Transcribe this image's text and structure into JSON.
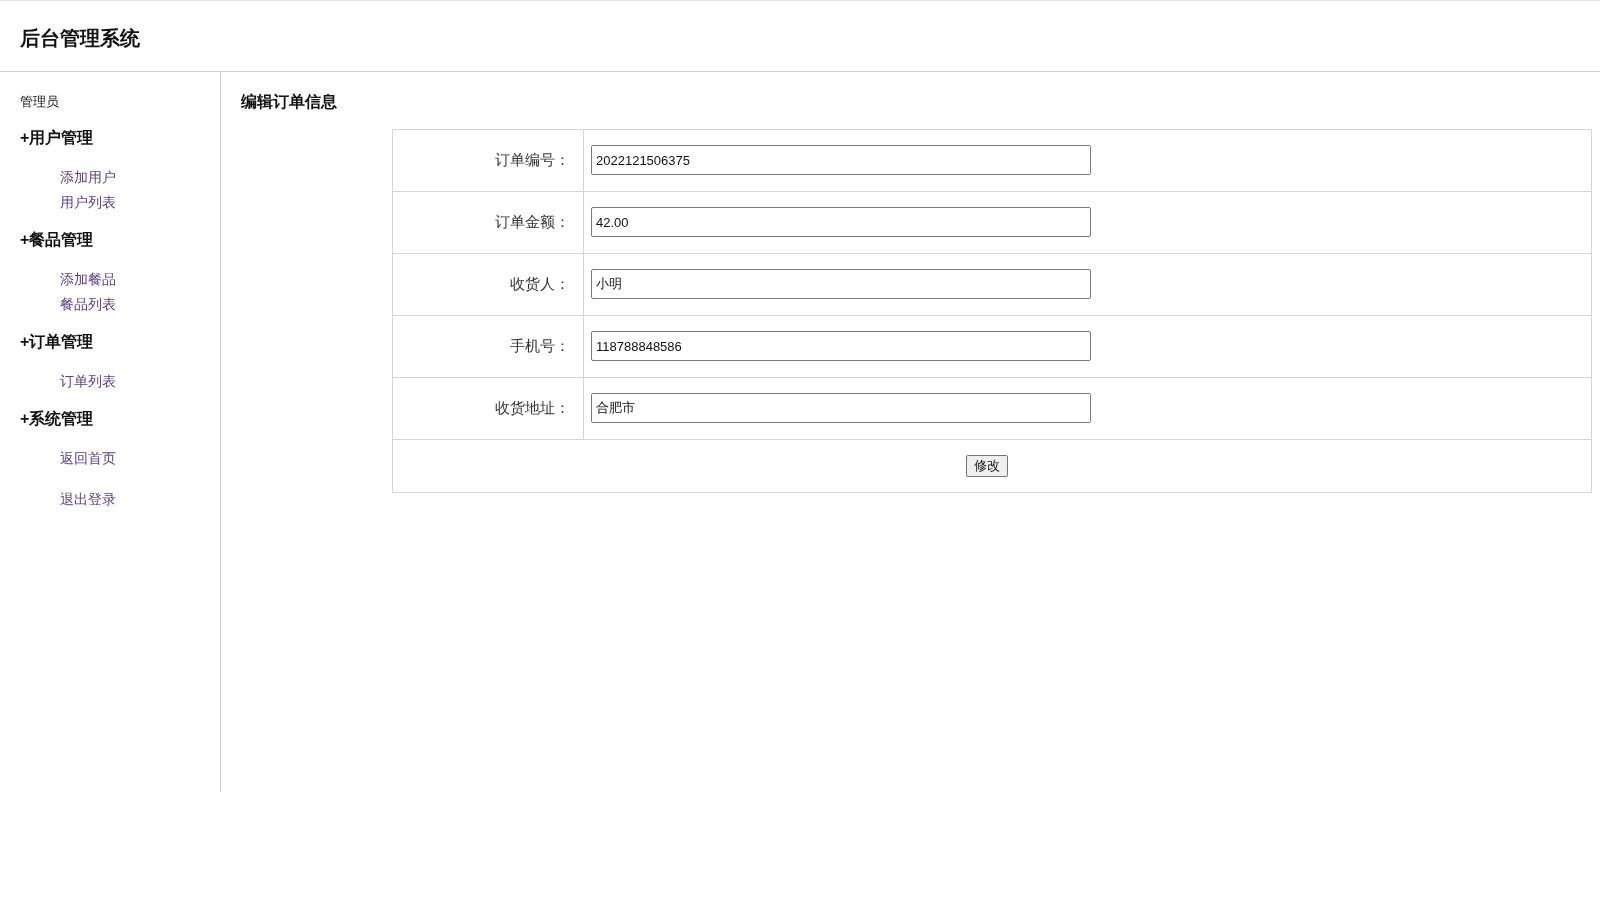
{
  "header": {
    "title": "后台管理系统"
  },
  "sidebar": {
    "role": "管理员",
    "groups": [
      {
        "title": "+用户管理",
        "lists": [
          [
            "添加用户",
            "用户列表"
          ]
        ]
      },
      {
        "title": "+餐品管理",
        "lists": [
          [
            "添加餐品",
            "餐品列表"
          ]
        ]
      },
      {
        "title": "+订单管理",
        "lists": [
          [
            "订单列表"
          ]
        ]
      },
      {
        "title": "+系统管理",
        "lists": [
          [
            "返回首页"
          ],
          [
            "退出登录"
          ]
        ]
      }
    ]
  },
  "main": {
    "title": "编辑订单信息",
    "form": {
      "fields": [
        {
          "label": "订单编号：",
          "value": "2022121506375"
        },
        {
          "label": "订单金额：",
          "value": "42.00"
        },
        {
          "label": "收货人：",
          "value": "小明"
        },
        {
          "label": "手机号：",
          "value": "118788848586"
        },
        {
          "label": "收货地址：",
          "value": "合肥市"
        }
      ],
      "submit": "修改"
    }
  }
}
